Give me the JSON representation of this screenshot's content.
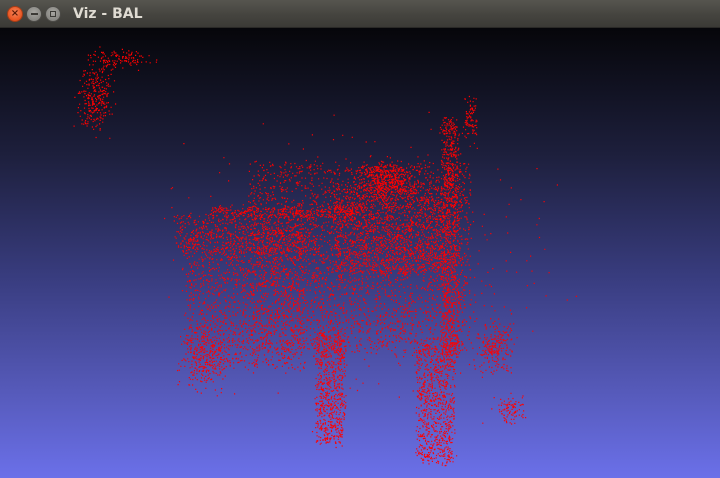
{
  "window": {
    "title": "Viz - BAL",
    "close_glyph": "×"
  },
  "icons": {
    "close": "close-icon",
    "minimize": "minimize-icon",
    "maximize": "maximize-icon"
  },
  "colors": {
    "point_color": "#ff0000",
    "background_top": "#06060a",
    "background_bottom": "#6b70e9",
    "close_button": "#e95420"
  }
}
